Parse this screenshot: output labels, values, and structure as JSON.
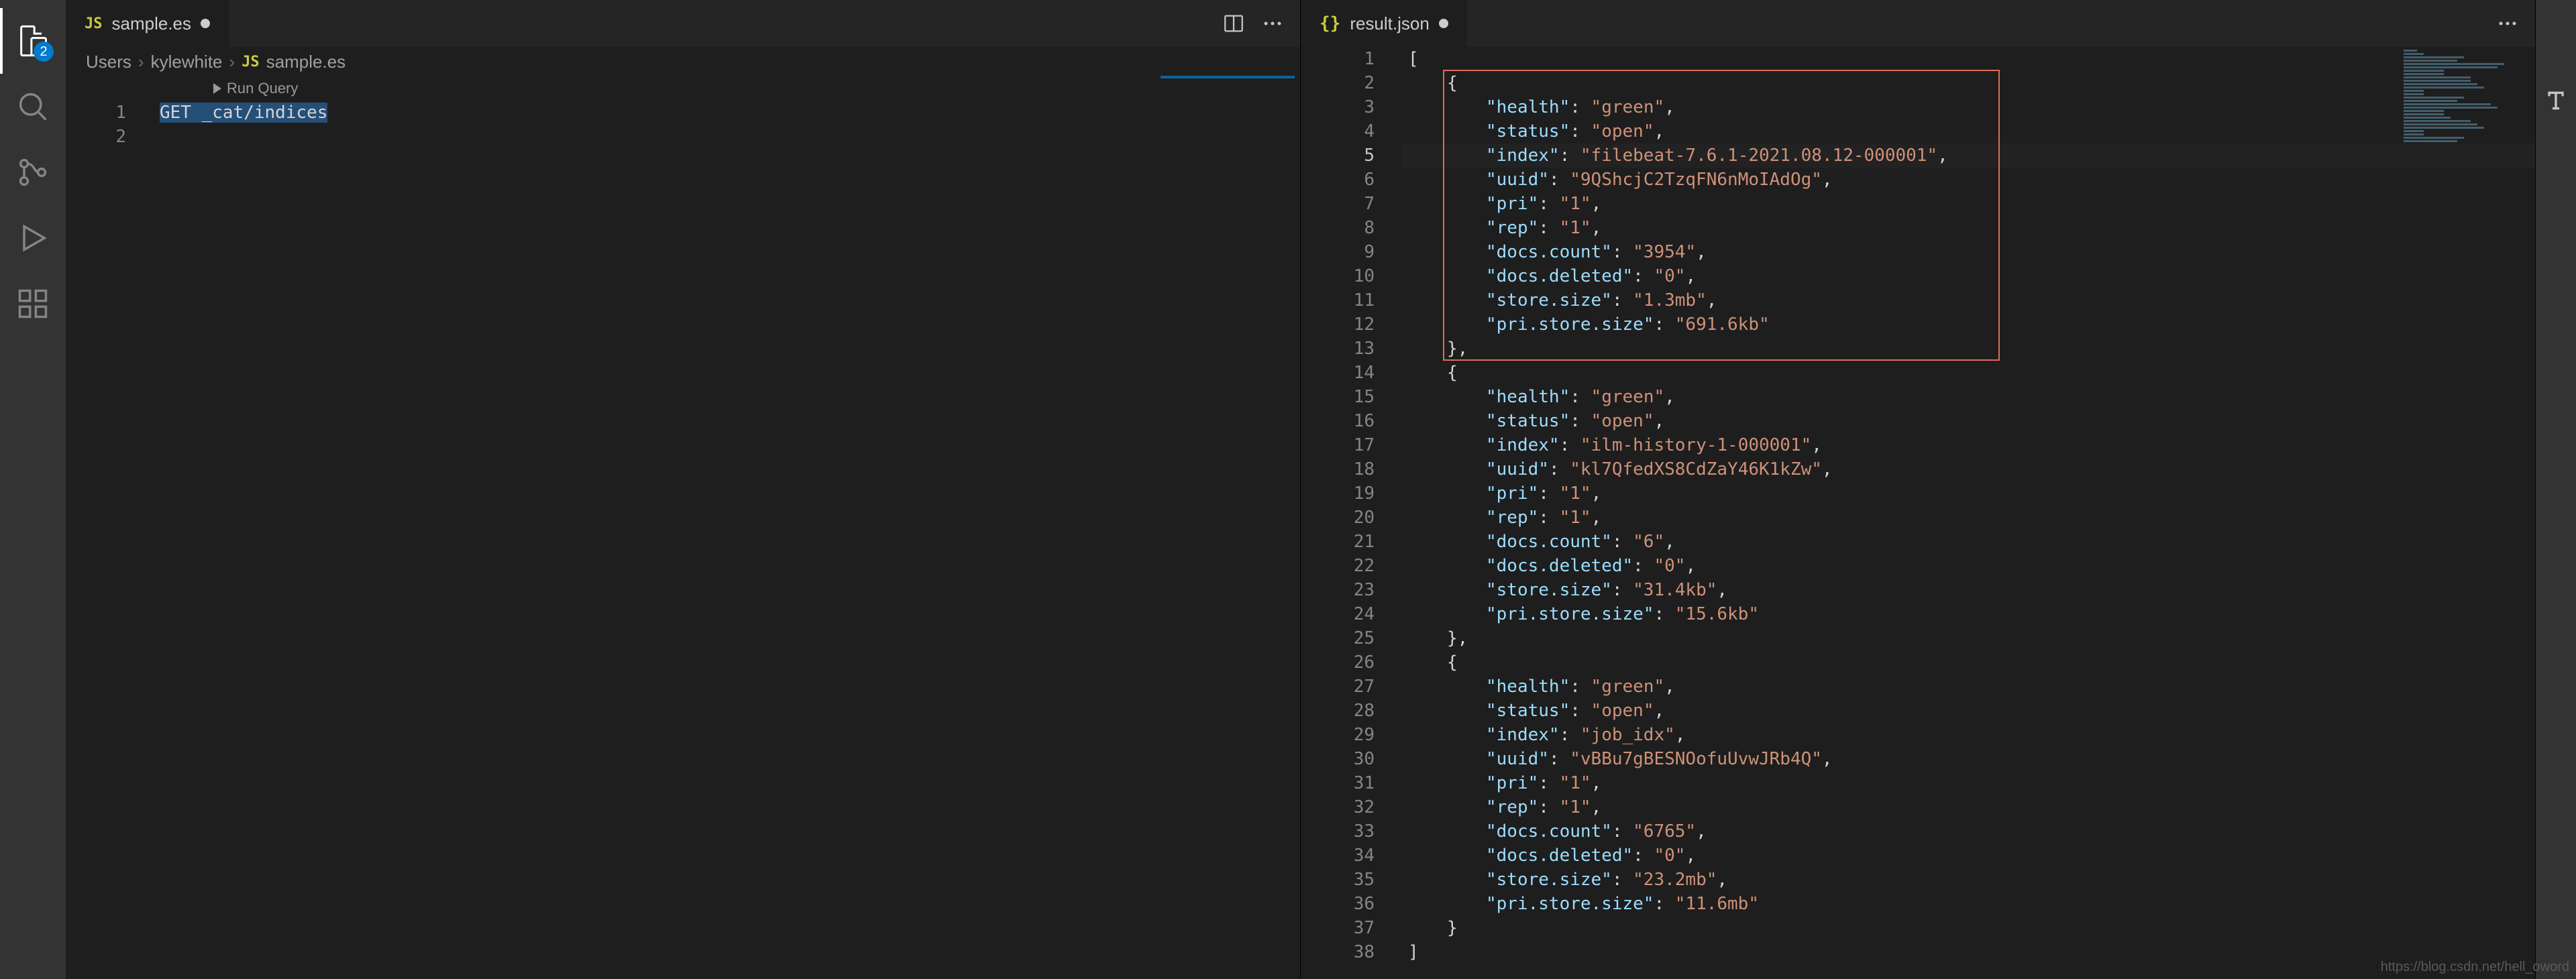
{
  "activity": {
    "explorer_badge": "2"
  },
  "left": {
    "tab": {
      "icon": "JS",
      "name": "sample.es",
      "modified": true
    },
    "breadcrumb": [
      "Users",
      "kylewhite",
      "sample.es"
    ],
    "codelens": "Run Query",
    "lines": [
      {
        "n": 1,
        "text": "GET _cat/indices",
        "selected": true
      },
      {
        "n": 2,
        "text": ""
      }
    ]
  },
  "right": {
    "tab": {
      "icon": "{}",
      "name": "result.json",
      "modified": true
    },
    "highlight": {
      "start": 2,
      "end": 13
    },
    "current_line": 5,
    "json_lines": [
      {
        "n": 1,
        "ind": 0,
        "tok": [
          [
            "p",
            "["
          ]
        ]
      },
      {
        "n": 2,
        "ind": 1,
        "tok": [
          [
            "p",
            "{"
          ]
        ]
      },
      {
        "n": 3,
        "ind": 2,
        "tok": [
          [
            "k",
            "\"health\""
          ],
          [
            "p",
            ": "
          ],
          [
            "s",
            "\"green\""
          ],
          [
            "p",
            ","
          ]
        ]
      },
      {
        "n": 4,
        "ind": 2,
        "tok": [
          [
            "k",
            "\"status\""
          ],
          [
            "p",
            ": "
          ],
          [
            "s",
            "\"open\""
          ],
          [
            "p",
            ","
          ]
        ]
      },
      {
        "n": 5,
        "ind": 2,
        "tok": [
          [
            "k",
            "\"index\""
          ],
          [
            "p",
            ": "
          ],
          [
            "s",
            "\"filebeat-7.6.1-2021.08.12-000001\""
          ],
          [
            "p",
            ","
          ]
        ]
      },
      {
        "n": 6,
        "ind": 2,
        "tok": [
          [
            "k",
            "\"uuid\""
          ],
          [
            "p",
            ": "
          ],
          [
            "s",
            "\"9QShcjC2TzqFN6nMoIAdOg\""
          ],
          [
            "p",
            ","
          ]
        ]
      },
      {
        "n": 7,
        "ind": 2,
        "tok": [
          [
            "k",
            "\"pri\""
          ],
          [
            "p",
            ": "
          ],
          [
            "s",
            "\"1\""
          ],
          [
            "p",
            ","
          ]
        ]
      },
      {
        "n": 8,
        "ind": 2,
        "tok": [
          [
            "k",
            "\"rep\""
          ],
          [
            "p",
            ": "
          ],
          [
            "s",
            "\"1\""
          ],
          [
            "p",
            ","
          ]
        ]
      },
      {
        "n": 9,
        "ind": 2,
        "tok": [
          [
            "k",
            "\"docs.count\""
          ],
          [
            "p",
            ": "
          ],
          [
            "s",
            "\"3954\""
          ],
          [
            "p",
            ","
          ]
        ]
      },
      {
        "n": 10,
        "ind": 2,
        "tok": [
          [
            "k",
            "\"docs.deleted\""
          ],
          [
            "p",
            ": "
          ],
          [
            "s",
            "\"0\""
          ],
          [
            "p",
            ","
          ]
        ]
      },
      {
        "n": 11,
        "ind": 2,
        "tok": [
          [
            "k",
            "\"store.size\""
          ],
          [
            "p",
            ": "
          ],
          [
            "s",
            "\"1.3mb\""
          ],
          [
            "p",
            ","
          ]
        ]
      },
      {
        "n": 12,
        "ind": 2,
        "tok": [
          [
            "k",
            "\"pri.store.size\""
          ],
          [
            "p",
            ": "
          ],
          [
            "s",
            "\"691.6kb\""
          ]
        ]
      },
      {
        "n": 13,
        "ind": 1,
        "tok": [
          [
            "p",
            "},"
          ]
        ]
      },
      {
        "n": 14,
        "ind": 1,
        "tok": [
          [
            "p",
            "{"
          ]
        ]
      },
      {
        "n": 15,
        "ind": 2,
        "tok": [
          [
            "k",
            "\"health\""
          ],
          [
            "p",
            ": "
          ],
          [
            "s",
            "\"green\""
          ],
          [
            "p",
            ","
          ]
        ]
      },
      {
        "n": 16,
        "ind": 2,
        "tok": [
          [
            "k",
            "\"status\""
          ],
          [
            "p",
            ": "
          ],
          [
            "s",
            "\"open\""
          ],
          [
            "p",
            ","
          ]
        ]
      },
      {
        "n": 17,
        "ind": 2,
        "tok": [
          [
            "k",
            "\"index\""
          ],
          [
            "p",
            ": "
          ],
          [
            "s",
            "\"ilm-history-1-000001\""
          ],
          [
            "p",
            ","
          ]
        ]
      },
      {
        "n": 18,
        "ind": 2,
        "tok": [
          [
            "k",
            "\"uuid\""
          ],
          [
            "p",
            ": "
          ],
          [
            "s",
            "\"kl7QfedXS8CdZaY46K1kZw\""
          ],
          [
            "p",
            ","
          ]
        ]
      },
      {
        "n": 19,
        "ind": 2,
        "tok": [
          [
            "k",
            "\"pri\""
          ],
          [
            "p",
            ": "
          ],
          [
            "s",
            "\"1\""
          ],
          [
            "p",
            ","
          ]
        ]
      },
      {
        "n": 20,
        "ind": 2,
        "tok": [
          [
            "k",
            "\"rep\""
          ],
          [
            "p",
            ": "
          ],
          [
            "s",
            "\"1\""
          ],
          [
            "p",
            ","
          ]
        ]
      },
      {
        "n": 21,
        "ind": 2,
        "tok": [
          [
            "k",
            "\"docs.count\""
          ],
          [
            "p",
            ": "
          ],
          [
            "s",
            "\"6\""
          ],
          [
            "p",
            ","
          ]
        ]
      },
      {
        "n": 22,
        "ind": 2,
        "tok": [
          [
            "k",
            "\"docs.deleted\""
          ],
          [
            "p",
            ": "
          ],
          [
            "s",
            "\"0\""
          ],
          [
            "p",
            ","
          ]
        ]
      },
      {
        "n": 23,
        "ind": 2,
        "tok": [
          [
            "k",
            "\"store.size\""
          ],
          [
            "p",
            ": "
          ],
          [
            "s",
            "\"31.4kb\""
          ],
          [
            "p",
            ","
          ]
        ]
      },
      {
        "n": 24,
        "ind": 2,
        "tok": [
          [
            "k",
            "\"pri.store.size\""
          ],
          [
            "p",
            ": "
          ],
          [
            "s",
            "\"15.6kb\""
          ]
        ]
      },
      {
        "n": 25,
        "ind": 1,
        "tok": [
          [
            "p",
            "},"
          ]
        ]
      },
      {
        "n": 26,
        "ind": 1,
        "tok": [
          [
            "p",
            "{"
          ]
        ]
      },
      {
        "n": 27,
        "ind": 2,
        "tok": [
          [
            "k",
            "\"health\""
          ],
          [
            "p",
            ": "
          ],
          [
            "s",
            "\"green\""
          ],
          [
            "p",
            ","
          ]
        ]
      },
      {
        "n": 28,
        "ind": 2,
        "tok": [
          [
            "k",
            "\"status\""
          ],
          [
            "p",
            ": "
          ],
          [
            "s",
            "\"open\""
          ],
          [
            "p",
            ","
          ]
        ]
      },
      {
        "n": 29,
        "ind": 2,
        "tok": [
          [
            "k",
            "\"index\""
          ],
          [
            "p",
            ": "
          ],
          [
            "s",
            "\"job_idx\""
          ],
          [
            "p",
            ","
          ]
        ]
      },
      {
        "n": 30,
        "ind": 2,
        "tok": [
          [
            "k",
            "\"uuid\""
          ],
          [
            "p",
            ": "
          ],
          [
            "s",
            "\"vBBu7gBESNOofuUvwJRb4Q\""
          ],
          [
            "p",
            ","
          ]
        ]
      },
      {
        "n": 31,
        "ind": 2,
        "tok": [
          [
            "k",
            "\"pri\""
          ],
          [
            "p",
            ": "
          ],
          [
            "s",
            "\"1\""
          ],
          [
            "p",
            ","
          ]
        ]
      },
      {
        "n": 32,
        "ind": 2,
        "tok": [
          [
            "k",
            "\"rep\""
          ],
          [
            "p",
            ": "
          ],
          [
            "s",
            "\"1\""
          ],
          [
            "p",
            ","
          ]
        ]
      },
      {
        "n": 33,
        "ind": 2,
        "tok": [
          [
            "k",
            "\"docs.count\""
          ],
          [
            "p",
            ": "
          ],
          [
            "s",
            "\"6765\""
          ],
          [
            "p",
            ","
          ]
        ]
      },
      {
        "n": 34,
        "ind": 2,
        "tok": [
          [
            "k",
            "\"docs.deleted\""
          ],
          [
            "p",
            ": "
          ],
          [
            "s",
            "\"0\""
          ],
          [
            "p",
            ","
          ]
        ]
      },
      {
        "n": 35,
        "ind": 2,
        "tok": [
          [
            "k",
            "\"store.size\""
          ],
          [
            "p",
            ": "
          ],
          [
            "s",
            "\"23.2mb\""
          ],
          [
            "p",
            ","
          ]
        ]
      },
      {
        "n": 36,
        "ind": 2,
        "tok": [
          [
            "k",
            "\"pri.store.size\""
          ],
          [
            "p",
            ": "
          ],
          [
            "s",
            "\"11.6mb\""
          ]
        ]
      },
      {
        "n": 37,
        "ind": 1,
        "tok": [
          [
            "p",
            "}"
          ]
        ]
      },
      {
        "n": 38,
        "ind": 0,
        "tok": [
          [
            "p",
            "]"
          ]
        ]
      }
    ]
  },
  "watermark": "https://blog.csdn.net/hell_oword"
}
